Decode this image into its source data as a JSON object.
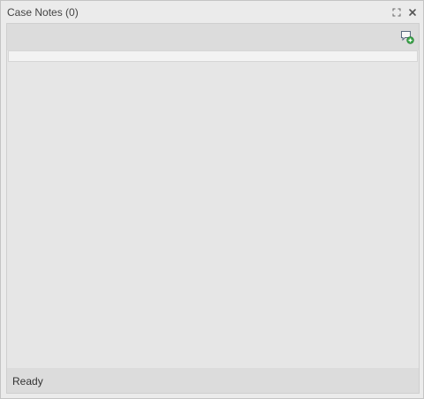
{
  "window": {
    "title": "Case Notes (0)",
    "controls": [
      {
        "name": "maximize-icon"
      },
      {
        "name": "close-icon"
      }
    ]
  },
  "toolbar": {
    "add_note_icon": "add-note-icon"
  },
  "status": {
    "text": "Ready"
  },
  "colors": {
    "background": "#ebebeb",
    "panel": "#e6e6e6",
    "toolbar": "#dcdcdc",
    "accent_green": "#3aa84a"
  }
}
